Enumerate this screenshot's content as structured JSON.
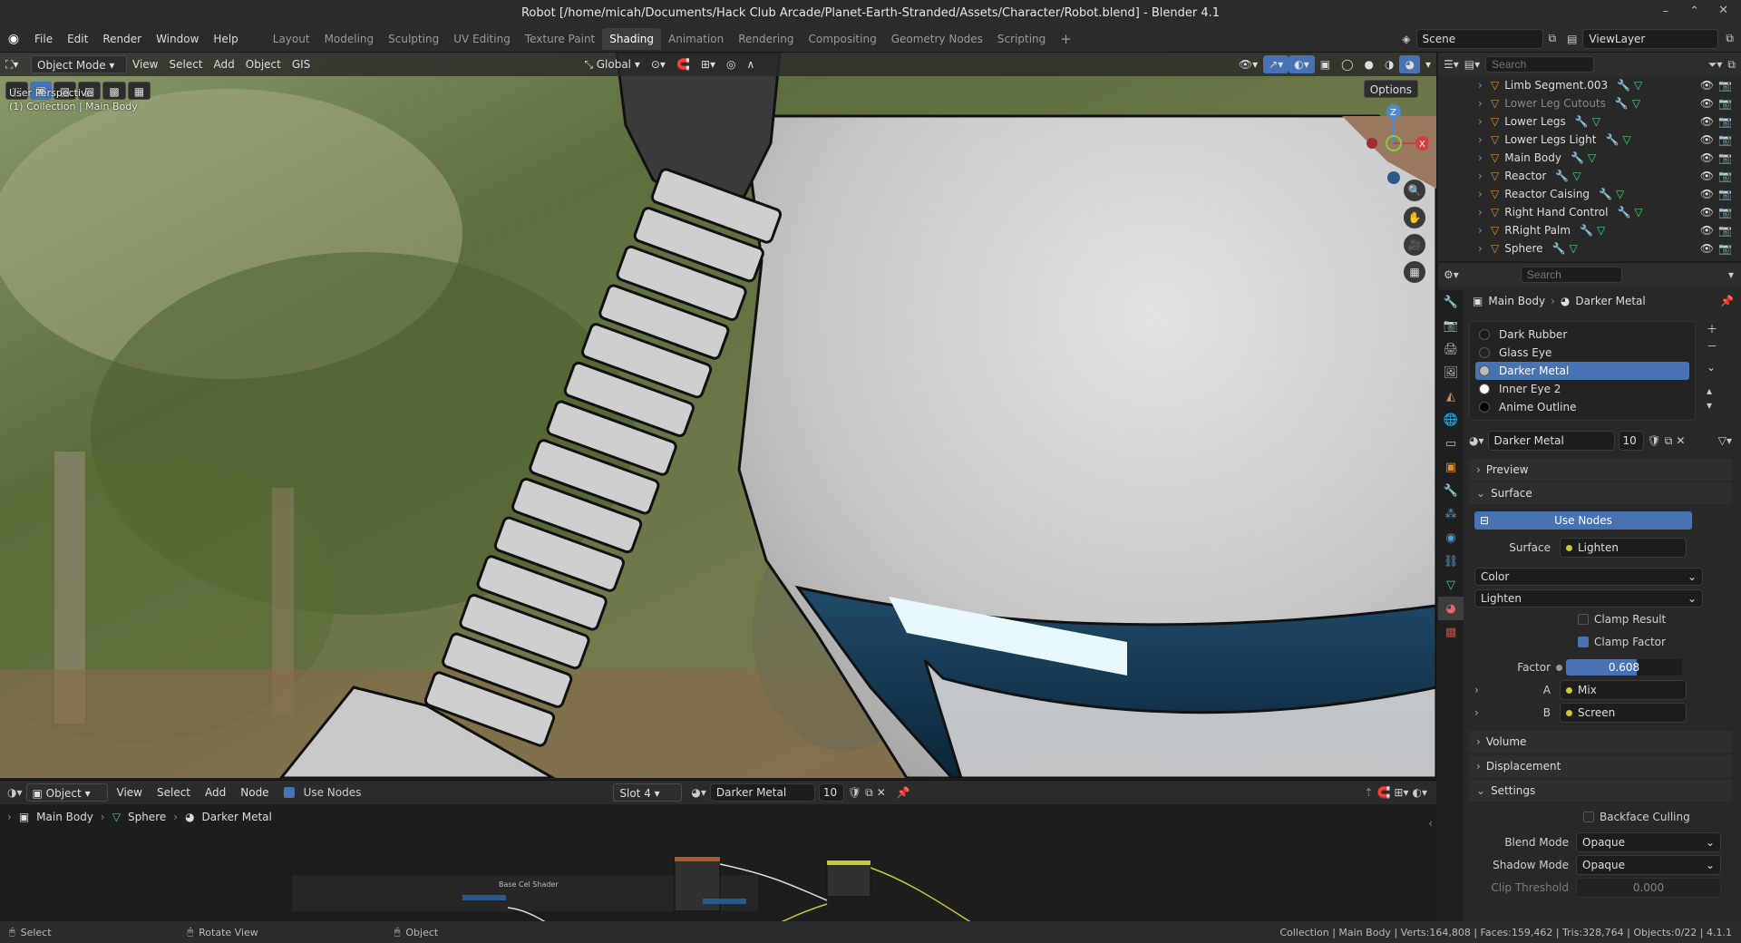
{
  "window": {
    "title": "Robot [/home/micah/Documents/Hack Club Arcade/Planet-Earth-Stranded/Assets/Character/Robot.blend] - Blender 4.1"
  },
  "menu": [
    "File",
    "Edit",
    "Render",
    "Window",
    "Help"
  ],
  "workspaces": [
    "Layout",
    "Modeling",
    "Sculpting",
    "UV Editing",
    "Texture Paint",
    "Shading",
    "Animation",
    "Rendering",
    "Compositing",
    "Geometry Nodes",
    "Scripting"
  ],
  "active_workspace": "Shading",
  "scene": {
    "name": "Scene",
    "view_layer": "ViewLayer"
  },
  "viewport": {
    "mode": "Object Mode",
    "menus": [
      "View",
      "Select",
      "Add",
      "Object",
      "GIS"
    ],
    "transform": "Global",
    "options": "Options",
    "overlay_line1": "User Perspective",
    "overlay_line2": "(1) Collection | Main Body",
    "gizmo": {
      "z": "Z",
      "x": "X"
    }
  },
  "outliner": {
    "search_placeholder": "Search",
    "items": [
      {
        "name": "Limb Segment.003",
        "dim": false
      },
      {
        "name": "Lower Leg Cutouts",
        "dim": true
      },
      {
        "name": "Lower Legs",
        "dim": false
      },
      {
        "name": "Lower Legs Light",
        "dim": false
      },
      {
        "name": "Main Body",
        "dim": false
      },
      {
        "name": "Reactor",
        "dim": false
      },
      {
        "name": "Reactor Caising",
        "dim": false
      },
      {
        "name": "Right Hand Control",
        "dim": false
      },
      {
        "name": "RRight Palm",
        "dim": false
      },
      {
        "name": "Sphere",
        "dim": false
      }
    ]
  },
  "properties": {
    "search_placeholder": "Search",
    "breadcrumb": {
      "object": "Main Body",
      "material": "Darker Metal"
    },
    "slots": [
      {
        "name": "Dark Rubber",
        "color": "#1a1a1a"
      },
      {
        "name": "Glass Eye",
        "color": "#222222"
      },
      {
        "name": "Darker Metal",
        "color": "#bbbbbb"
      },
      {
        "name": "Inner Eye 2",
        "color": "#ffffff"
      },
      {
        "name": "Anime Outline",
        "color": "#000000"
      }
    ],
    "active_slot": "Darker Metal",
    "material_name": "Darker Metal",
    "user_count": "10",
    "panels": {
      "preview": "Preview",
      "surface": "Surface",
      "volume": "Volume",
      "displacement": "Displacement",
      "settings": "Settings"
    },
    "use_nodes": "Use Nodes",
    "surface_label": "Surface",
    "surface_value": "Lighten",
    "color_dropdown": "Color",
    "blend_dropdown": "Lighten",
    "clamp_result": "Clamp Result",
    "clamp_factor": "Clamp Factor",
    "factor_label": "Factor",
    "factor_value": "0.608",
    "factor_fraction": 0.608,
    "input_a_label": "A",
    "input_a_value": "Mix",
    "input_b_label": "B",
    "input_b_value": "Screen",
    "backface_culling": "Backface Culling",
    "blend_mode_label": "Blend Mode",
    "blend_mode_value": "Opaque",
    "shadow_mode_label": "Shadow Mode",
    "shadow_mode_value": "Opaque",
    "clip_threshold_label": "Clip Threshold",
    "clip_threshold_value": "0.000"
  },
  "node_editor": {
    "object_dd": "Object",
    "menus": [
      "View",
      "Select",
      "Add",
      "Node"
    ],
    "use_nodes": "Use Nodes",
    "slot": "Slot 4",
    "material": "Darker Metal",
    "users": "10",
    "breadcrumb": [
      "Main Body",
      "Sphere",
      "Darker Metal"
    ],
    "frame_label": "Base Cel Shader"
  },
  "status": {
    "select": "Select",
    "rotate": "Rotate View",
    "object": "Object",
    "stats": "Collection | Main Body | Verts:164,808 | Faces:159,462 | Tris:328,764 | Objects:0/22 | 4.1.1"
  },
  "colors": {
    "accent": "#4772b3",
    "bg_panel": "#282828",
    "yellow_link": "#c8c832",
    "eye_glow": "#e8f8ff"
  }
}
